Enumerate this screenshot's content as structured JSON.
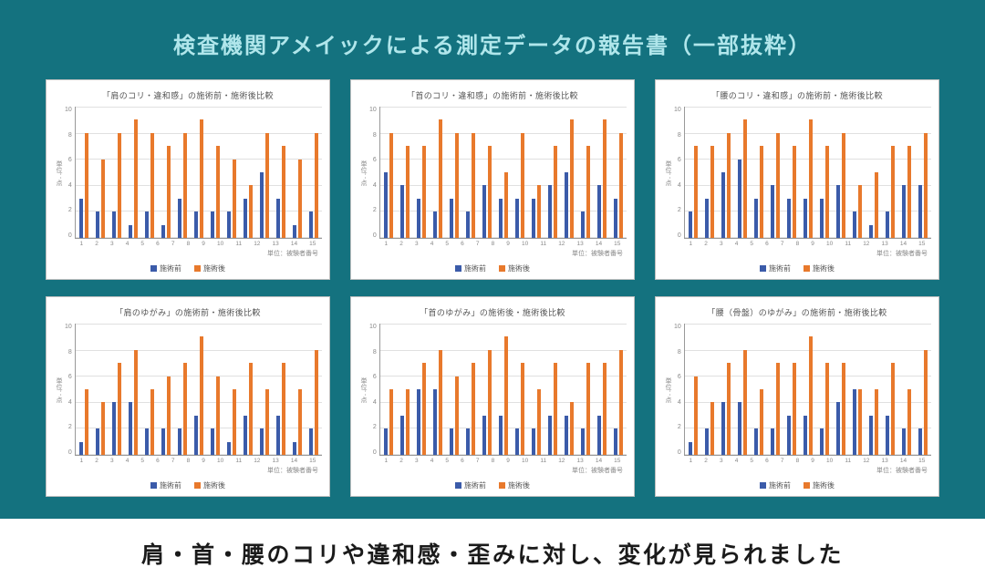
{
  "heading": "検査機関アメイックによる測定データの報告書（一部抜粋）",
  "footer": "肩・首・腰のコリや違和感・歪みに対し、変化が見られました",
  "legend": {
    "before": "施術前",
    "after": "施術後"
  },
  "axis": {
    "ylabel": "単位：点",
    "xlabel": "単位：被験者番号"
  },
  "chart_data": [
    {
      "type": "bar",
      "title": "「肩のコリ・違和感」の施術前・施術後比較",
      "categories": [
        1,
        2,
        3,
        4,
        5,
        6,
        7,
        8,
        9,
        10,
        11,
        12,
        13,
        14,
        15
      ],
      "series": [
        {
          "name": "施術前",
          "values": [
            3,
            2,
            2,
            1,
            2,
            1,
            3,
            2,
            2,
            2,
            3,
            5,
            3,
            1,
            2
          ]
        },
        {
          "name": "施術後",
          "values": [
            8,
            6,
            8,
            9,
            8,
            7,
            8,
            9,
            7,
            6,
            4,
            8,
            7,
            6,
            8
          ]
        }
      ],
      "ylim": [
        0,
        10
      ],
      "xlabel": "単位：被験者番号",
      "ylabel": "単位：点"
    },
    {
      "type": "bar",
      "title": "「首のコリ・違和感」の施術前・施術後比較",
      "categories": [
        1,
        2,
        3,
        4,
        5,
        6,
        7,
        8,
        9,
        10,
        11,
        12,
        13,
        14,
        15
      ],
      "series": [
        {
          "name": "施術前",
          "values": [
            5,
            4,
            3,
            2,
            3,
            2,
            4,
            3,
            3,
            3,
            4,
            5,
            2,
            4,
            3
          ]
        },
        {
          "name": "施術後",
          "values": [
            8,
            7,
            7,
            9,
            8,
            8,
            7,
            5,
            8,
            4,
            7,
            9,
            7,
            9,
            8
          ]
        }
      ],
      "ylim": [
        0,
        10
      ],
      "xlabel": "単位：被験者番号",
      "ylabel": "単位：点"
    },
    {
      "type": "bar",
      "title": "「腰のコリ・違和感」の施術前・施術後比較",
      "categories": [
        1,
        2,
        3,
        4,
        5,
        6,
        7,
        8,
        9,
        10,
        11,
        12,
        13,
        14,
        15
      ],
      "series": [
        {
          "name": "施術前",
          "values": [
            2,
            3,
            5,
            6,
            3,
            4,
            3,
            3,
            3,
            4,
            2,
            1,
            2,
            4,
            4
          ]
        },
        {
          "name": "施術後",
          "values": [
            7,
            7,
            8,
            9,
            7,
            8,
            7,
            9,
            7,
            8,
            4,
            5,
            7,
            7,
            8
          ]
        }
      ],
      "ylim": [
        0,
        10
      ],
      "xlabel": "単位：被験者番号",
      "ylabel": "単位：点"
    },
    {
      "type": "bar",
      "title": "「肩のゆがみ」の施術前・施術後比較",
      "categories": [
        1,
        2,
        3,
        4,
        5,
        6,
        7,
        8,
        9,
        10,
        11,
        12,
        13,
        14,
        15
      ],
      "series": [
        {
          "name": "施術前",
          "values": [
            1,
            2,
            4,
            4,
            2,
            2,
            2,
            3,
            2,
            1,
            3,
            2,
            3,
            1,
            2
          ]
        },
        {
          "name": "施術後",
          "values": [
            5,
            4,
            7,
            8,
            5,
            6,
            7,
            9,
            6,
            5,
            7,
            5,
            7,
            5,
            8
          ]
        }
      ],
      "ylim": [
        0,
        10
      ],
      "xlabel": "単位：被験者番号",
      "ylabel": "単位：点"
    },
    {
      "type": "bar",
      "title": "「首のゆがみ」の施術後・施術後比較",
      "categories": [
        1,
        2,
        3,
        4,
        5,
        6,
        7,
        8,
        9,
        10,
        11,
        12,
        13,
        14,
        15
      ],
      "series": [
        {
          "name": "施術前",
          "values": [
            2,
            3,
            5,
            5,
            2,
            2,
            3,
            3,
            2,
            2,
            3,
            3,
            2,
            3,
            2
          ]
        },
        {
          "name": "施術後",
          "values": [
            5,
            5,
            7,
            8,
            6,
            7,
            8,
            9,
            7,
            5,
            7,
            4,
            7,
            7,
            8
          ]
        }
      ],
      "ylim": [
        0,
        10
      ],
      "xlabel": "単位：被験者番号",
      "ylabel": "単位：点"
    },
    {
      "type": "bar",
      "title": "「腰（骨盤）のゆがみ」の施術前・施術後比較",
      "categories": [
        1,
        2,
        3,
        4,
        5,
        6,
        7,
        8,
        9,
        10,
        11,
        12,
        13,
        14,
        15
      ],
      "series": [
        {
          "name": "施術前",
          "values": [
            1,
            2,
            4,
            4,
            2,
            2,
            3,
            3,
            2,
            4,
            5,
            3,
            3,
            2,
            2
          ]
        },
        {
          "name": "施術後",
          "values": [
            6,
            4,
            7,
            8,
            5,
            7,
            7,
            9,
            7,
            7,
            5,
            5,
            7,
            5,
            8
          ]
        }
      ],
      "ylim": [
        0,
        10
      ],
      "xlabel": "単位：被験者番号",
      "ylabel": "単位：点"
    }
  ]
}
